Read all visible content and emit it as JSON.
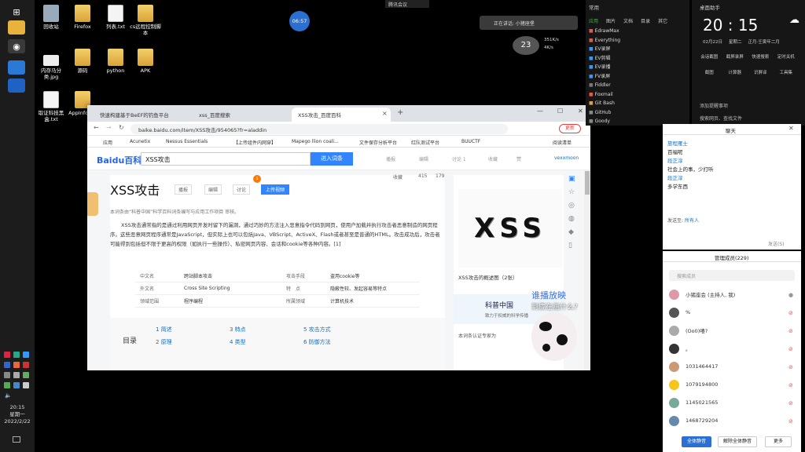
{
  "desktop": {
    "icons": [
      {
        "label": "回收站"
      },
      {
        "label": "Firefox"
      },
      {
        "label": "列表.txt"
      },
      {
        "label": "cs远程控制脚本"
      },
      {
        "label": "内存马分类.jpg"
      },
      {
        "label": "源码"
      },
      {
        "label": "python"
      },
      {
        "label": "APK"
      },
      {
        "label": "取证科技黑盒.txt"
      },
      {
        "label": "AppInfoner"
      }
    ]
  },
  "taskbar": {
    "time": "20:15",
    "weekday": "星期一",
    "date": "2022/2/22"
  },
  "overlay": {
    "top_circle": "06:57",
    "meeting": "腾讯会议",
    "speaking": "正在讲话: 小猪座堡",
    "net_percent": "23",
    "net_up": "351K/s",
    "net_down": "4K/s"
  },
  "browser": {
    "tabs": [
      {
        "label": "快速构建基于BeEF的钓鱼平台"
      },
      {
        "label": "xss_百度搜索"
      },
      {
        "label": "XSS攻击_百度百科"
      }
    ],
    "url": "baike.baidu.com/item/XSS攻击/954065?fr=aladdin",
    "update_label": "更新",
    "bookmarks": [
      "应用",
      "Acunetix",
      "Nessus Essentials",
      "【上传组件内网穿】",
      "Mapego llion coali...",
      "文件保存分析平台",
      "红队测试平台",
      "BUUCTF",
      "阅读清单"
    ],
    "baike": {
      "logo": "Baidu百科",
      "search_value": "XSS攻击",
      "search_button": "进入词条",
      "header_links": [
        "播报",
        "编辑",
        "讨论 1",
        "收藏",
        "赞"
      ],
      "user": "vexxmoon",
      "title": "XSS攻击",
      "title_actions": [
        "播报",
        "编辑",
        "讨论",
        "上传视频"
      ],
      "badge": "1",
      "stats": {
        "collect": "收藏",
        "likes": "415",
        "shares": "179"
      },
      "notice": "本词条由“科普中国”科学百科词条编写与应用工作项目 审核。",
      "summary": "XSS攻击通常指的是通过利用网页开发时留下的漏洞，通过巧妙的方法注入恶意指令代码到网页，使用户加载并执行攻击者恶意制造的网页程序。这些恶意网页程序通常是JavaScript，但实际上也可以包括Java、VBScript、ActiveX、Flash或者甚至是普通的HTML。攻击成功后，攻击者可能得到包括但不限于更高的权限（如执行一些操作）、私密网页内容、会话和cookie等各种内容。[1]",
      "info": [
        [
          "中文名",
          "跨站脚本攻击",
          "攻击手段",
          "盗用cookie等"
        ],
        [
          "外文名",
          "Cross Site Scripting",
          "特　点",
          "隐蔽性较、发起容易等特点"
        ],
        [
          "领域范围",
          "程序编程",
          "所属领域",
          "计算机技术"
        ]
      ],
      "toc_title": "目录",
      "toc": [
        "1  简述",
        "2  原理",
        "3  特点",
        "4  类型",
        "5  攻击方式",
        "6  防御方法"
      ],
      "image_text": "XSS",
      "image_caption": "XSS攻击的概述图（2张）",
      "kepu_title": "科普中国",
      "kepu_sub": "致力于权威的科学传播",
      "kepu_footer": "本词条认证专家为"
    }
  },
  "danmaku": {
    "line1": "谁播放映",
    "line2": "到底在画什么?"
  },
  "recent_panel": {
    "title": "常用",
    "tabs": [
      "应用",
      "图片",
      "文档",
      "目录",
      "其它"
    ],
    "items": [
      "EdrawMax",
      "Everything",
      "EV录屏",
      "EV剪辑",
      "EV录播",
      "FV录屏",
      "Fiddler",
      "Foxmail",
      "Git Bash",
      "GitHub",
      "Goody"
    ]
  },
  "clock_panel": {
    "title": "桌面助手",
    "time": "20 : 15",
    "date": "02月22日",
    "weekday": "星期二",
    "lunar": "正月·壬寅年二月",
    "actions": [
      "会话截图",
      "截屏录屏",
      "快速搜索",
      "定时关机",
      "截图",
      "计算器",
      "识屏译",
      "工具集"
    ],
    "rows": [
      "添加提醒事项",
      "搜索网页、查找文件"
    ]
  },
  "chat_panel1": {
    "title": "聊天",
    "messages": [
      {
        "name": "旅程雁士",
        "text": "百福呢"
      },
      {
        "name": "段正淳",
        "text": "社会上的事，少打听"
      },
      {
        "name": "段正淳",
        "text": "多学东西"
      }
    ],
    "send_to_label": "发送至:",
    "send_to_value": "所有人",
    "send_button": "发送(S)"
  },
  "chat_panel2": {
    "title": "管理成员(229)",
    "search_placeholder": "搜索成员",
    "members": [
      "小猪座会 (主持人, 我)",
      "%",
      "(Oo0)嘻?",
      "。",
      "1031464417",
      "1079194800",
      "1145021565",
      "1468729204"
    ],
    "mute_all": "全体静音",
    "unmute_all": "解除全体静音",
    "more": "更多"
  }
}
